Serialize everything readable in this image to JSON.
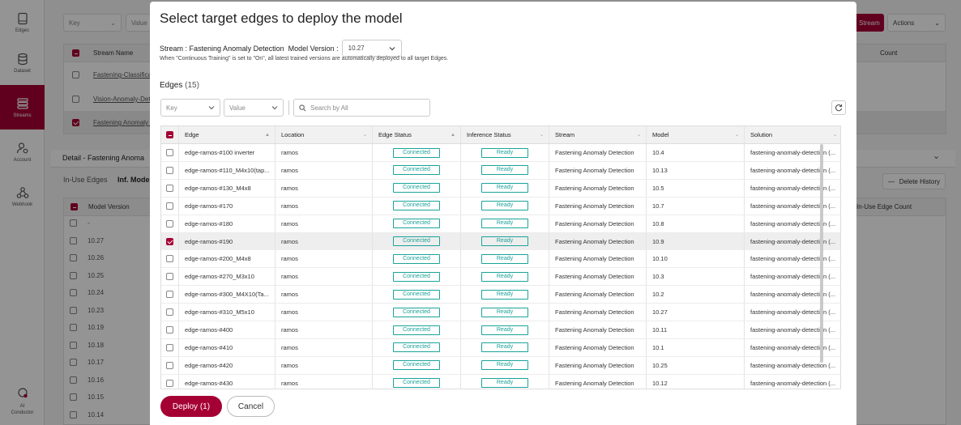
{
  "sidebar": {
    "items": [
      {
        "label": "Edges",
        "icon": "tablet-icon"
      },
      {
        "label": "Dataset",
        "icon": "database-icon"
      },
      {
        "label": "Streams",
        "icon": "streams-icon"
      },
      {
        "label": "Account",
        "icon": "account-gear-icon"
      },
      {
        "label": "Webhook",
        "icon": "webhook-icon"
      },
      {
        "label": "AI Conductor",
        "icon": "ai-conductor-logo"
      }
    ],
    "active": "Streams"
  },
  "background": {
    "key_placeholder": "Key",
    "value_placeholder": "Value",
    "stream_button": "Stream",
    "actions_label": "Actions",
    "table_header_stream_name": "Stream Name",
    "table_header_count": "Count",
    "stream_rows": [
      "Fastening-Classificat",
      "Vision-Anomaly-Dete",
      "Fastening Anomaly D"
    ],
    "detail_title": "Detail - Fastening Anoma",
    "tabs": [
      "In-Use Edges",
      "Inf. Model"
    ],
    "delete_history": "Delete History",
    "model_version_header": "Model Version",
    "in_use_count_header": "In-Use Edge Count",
    "versions": [
      "-",
      "10.27",
      "10.26",
      "10.25",
      "10.24",
      "10.23",
      "10.19",
      "10.18",
      "10.17",
      "10.16",
      "10.15",
      "10.14"
    ]
  },
  "modal": {
    "title": "Select target edges to deploy the model",
    "stream_label": "Stream :",
    "stream_value": "Fastening Anomaly Detection",
    "model_version_label": "Model Version :",
    "model_version_value": "10.27",
    "note": "When \"Continuous Training\" is set to \"On\", all latest trained versions are automatically deployed to all target Edges.",
    "edges_label": "Edges",
    "edges_count": "(15)",
    "key_placeholder": "Key",
    "value_placeholder": "Value",
    "search_placeholder": "Search by All",
    "deploy_label": "Deploy (1)",
    "cancel_label": "Cancel"
  },
  "table": {
    "headers": [
      "Edge",
      "Location",
      "Edge Status",
      "Inference Status",
      "Stream",
      "Model",
      "Solution"
    ],
    "rows": [
      {
        "edge": "edge-ramos-#100 inverter",
        "location": "ramos",
        "edge_status": "Connected",
        "inference_status": "Ready",
        "stream": "Fastening Anomaly Detection",
        "model": "10.4",
        "solution": "fastening-anomaly-detection (...",
        "selected": false
      },
      {
        "edge": "edge-ramos-#110_M4x10(tap...",
        "location": "ramos",
        "edge_status": "Connected",
        "inference_status": "Ready",
        "stream": "Fastening Anomaly Detection",
        "model": "10.13",
        "solution": "fastening-anomaly-detection (...",
        "selected": false
      },
      {
        "edge": "edge-ramos-#130_M4x8",
        "location": "ramos",
        "edge_status": "Connected",
        "inference_status": "Ready",
        "stream": "Fastening Anomaly Detection",
        "model": "10.5",
        "solution": "fastening-anomaly-detection (...",
        "selected": false
      },
      {
        "edge": "edge-ramos-#170",
        "location": "ramos",
        "edge_status": "Connected",
        "inference_status": "Ready",
        "stream": "Fastening Anomaly Detection",
        "model": "10.7",
        "solution": "fastening-anomaly-detection (...",
        "selected": false
      },
      {
        "edge": "edge-ramos-#180",
        "location": "ramos",
        "edge_status": "Connected",
        "inference_status": "Ready",
        "stream": "Fastening Anomaly Detection",
        "model": "10.8",
        "solution": "fastening-anomaly-detection (...",
        "selected": false
      },
      {
        "edge": "edge-ramos-#190",
        "location": "ramos",
        "edge_status": "Connected",
        "inference_status": "Ready",
        "stream": "Fastening Anomaly Detection",
        "model": "10.9",
        "solution": "fastening-anomaly-detection (...",
        "selected": true
      },
      {
        "edge": "edge-ramos-#200_M4x8",
        "location": "ramos",
        "edge_status": "Connected",
        "inference_status": "Ready",
        "stream": "Fastening Anomaly Detection",
        "model": "10.10",
        "solution": "fastening-anomaly-detection (...",
        "selected": false
      },
      {
        "edge": "edge-ramos-#270_M3x10",
        "location": "ramos",
        "edge_status": "Connected",
        "inference_status": "Ready",
        "stream": "Fastening Anomaly Detection",
        "model": "10.3",
        "solution": "fastening-anomaly-detection (...",
        "selected": false
      },
      {
        "edge": "edge-ramos-#300_M4X10(Ta...",
        "location": "ramos",
        "edge_status": "Connected",
        "inference_status": "Ready",
        "stream": "Fastening Anomaly Detection",
        "model": "10.2",
        "solution": "fastening-anomaly-detection (...",
        "selected": false
      },
      {
        "edge": "edge-ramos-#310_M5x10",
        "location": "ramos",
        "edge_status": "Connected",
        "inference_status": "Ready",
        "stream": "Fastening Anomaly Detection",
        "model": "10.27",
        "solution": "fastening-anomaly-detection (...",
        "selected": false
      },
      {
        "edge": "edge-ramos-#400",
        "location": "ramos",
        "edge_status": "Connected",
        "inference_status": "Ready",
        "stream": "Fastening Anomaly Detection",
        "model": "10.11",
        "solution": "fastening-anomaly-detection (...",
        "selected": false
      },
      {
        "edge": "edge-ramos-#410",
        "location": "ramos",
        "edge_status": "Connected",
        "inference_status": "Ready",
        "stream": "Fastening Anomaly Detection",
        "model": "10.1",
        "solution": "fastening-anomaly-detection (...",
        "selected": false
      },
      {
        "edge": "edge-ramos-#420",
        "location": "ramos",
        "edge_status": "Connected",
        "inference_status": "Ready",
        "stream": "Fastening Anomaly Detection",
        "model": "10.25",
        "solution": "fastening-anomaly-detection (...",
        "selected": false
      },
      {
        "edge": "edge-ramos-#430",
        "location": "ramos",
        "edge_status": "Connected",
        "inference_status": "Ready",
        "stream": "Fastening Anomaly Detection",
        "model": "10.12",
        "solution": "fastening-anomaly-detection (...",
        "selected": false
      }
    ]
  },
  "colors": {
    "accent": "#a50034",
    "status": "#1aa39a"
  }
}
